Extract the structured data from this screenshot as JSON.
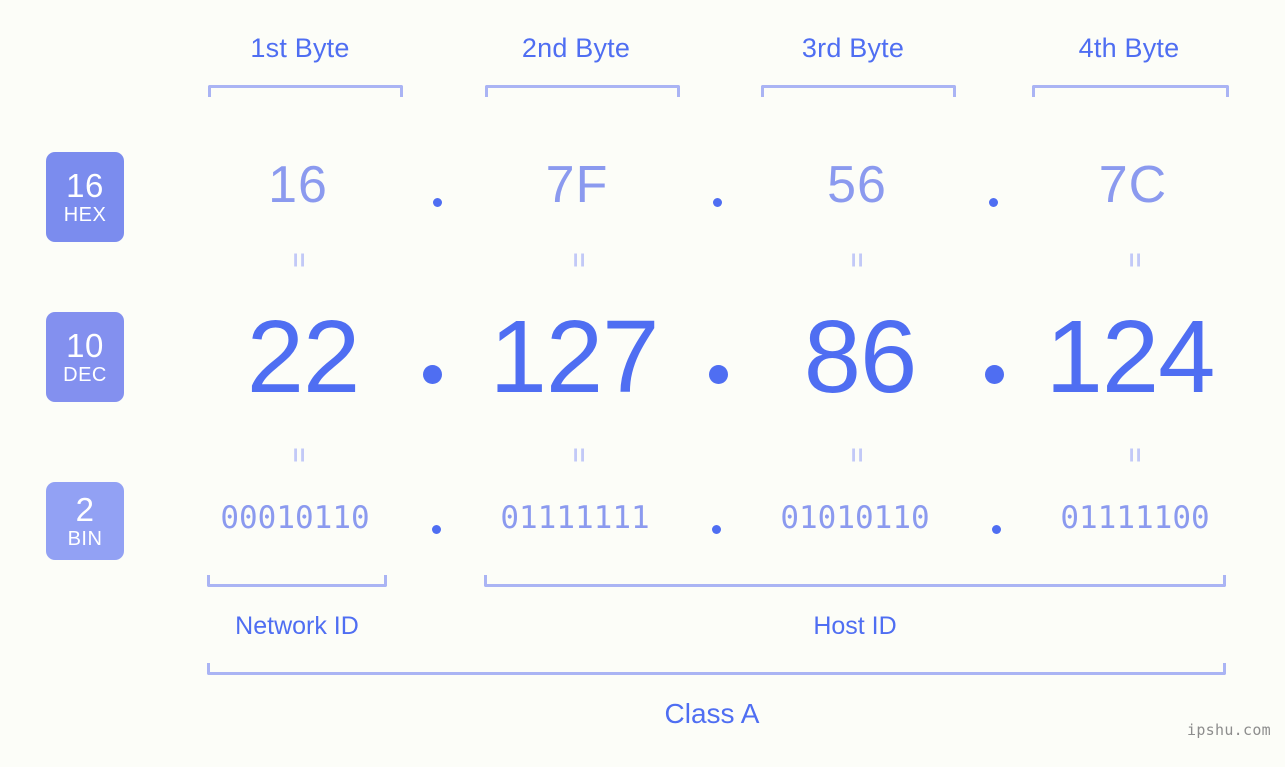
{
  "colors": {
    "background": "#fcfdf8",
    "accent_strong": "#4f6ef2",
    "accent_light": "#8b9aef",
    "bracket": "#aab4f4",
    "badge_hex": "#7b8cee",
    "badge_dec": "#8390ef",
    "badge_bin": "#92a1f4",
    "watermark": "#8d8d8d"
  },
  "byte_headers": [
    {
      "label": "1st Byte"
    },
    {
      "label": "2nd Byte"
    },
    {
      "label": "3rd Byte"
    },
    {
      "label": "4th Byte"
    }
  ],
  "rows": {
    "hex": {
      "badge_base": "16",
      "badge_name": "HEX",
      "values": [
        "16",
        "7F",
        "56",
        "7C"
      ],
      "separator": "."
    },
    "dec": {
      "badge_base": "10",
      "badge_name": "DEC",
      "values": [
        "22",
        "127",
        "86",
        "124"
      ],
      "separator": "."
    },
    "bin": {
      "badge_base": "2",
      "badge_name": "BIN",
      "values": [
        "00010110",
        "01111111",
        "01010110",
        "01111100"
      ],
      "separator": "."
    }
  },
  "equality_symbol": "=",
  "sections": {
    "network_id": "Network ID",
    "host_id": "Host ID",
    "class": "Class A"
  },
  "watermark": "ipshu.com"
}
